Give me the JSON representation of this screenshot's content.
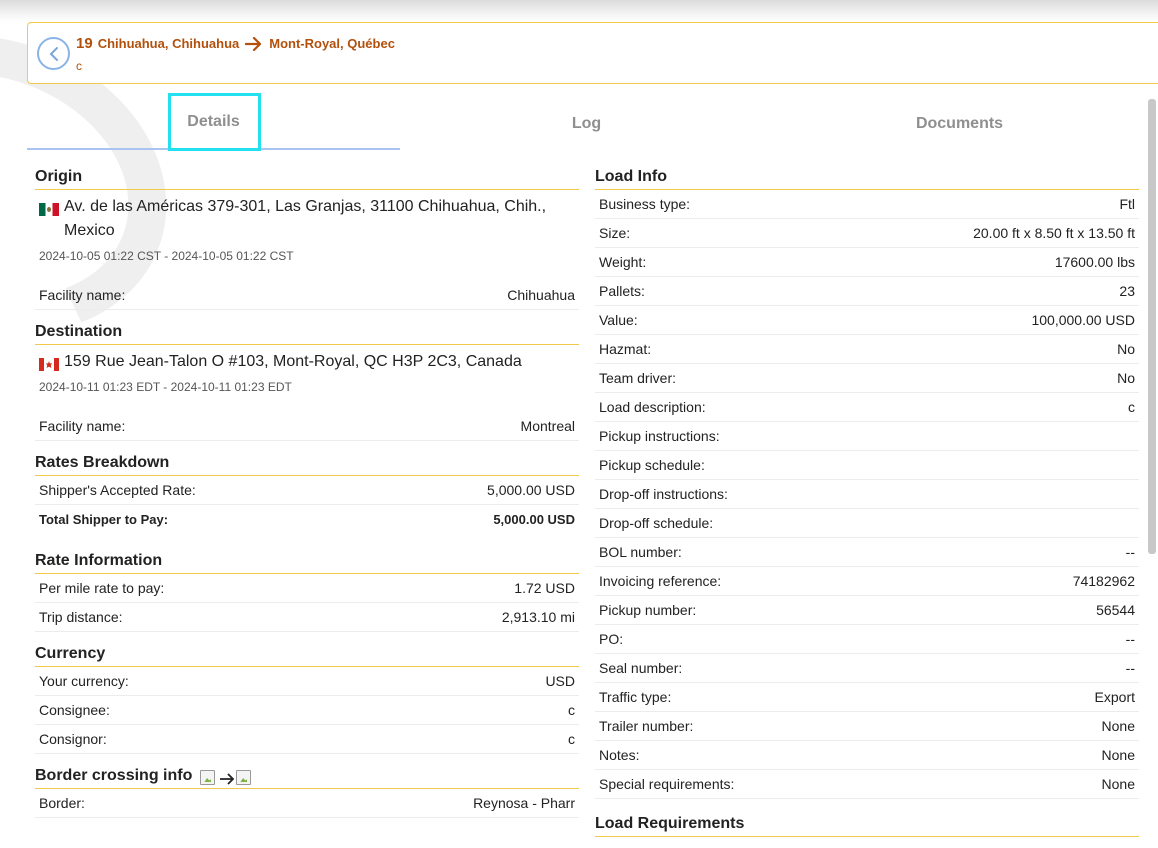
{
  "header": {
    "load_number": "19",
    "origin_city": "Chihuahua, Chihuahua",
    "destination_city": "Mont-Royal, Québec",
    "subline": "c"
  },
  "tabs": [
    {
      "label": "Details",
      "active": true
    },
    {
      "label": "Log",
      "active": false
    },
    {
      "label": "Documents",
      "active": false
    }
  ],
  "origin": {
    "title": "Origin",
    "address": "Av. de las Américas 379-301, Las Granjas, 31100 Chihuahua, Chih., Mexico",
    "dates": "2024-10-05 01:22 CST - 2024-10-05 01:22 CST",
    "facility_label": "Facility name:",
    "facility_value": "Chihuahua"
  },
  "destination": {
    "title": "Destination",
    "address": "159 Rue Jean-Talon O #103, Mont-Royal, QC H3P 2C3, Canada",
    "dates": "2024-10-11 01:23 EDT - 2024-10-11 01:23 EDT",
    "facility_label": "Facility name:",
    "facility_value": "Montreal"
  },
  "rates_breakdown": {
    "title": "Rates Breakdown",
    "rows": [
      {
        "label": "Shipper's Accepted Rate:",
        "value": "5,000.00 USD"
      },
      {
        "label": "Total Shipper to Pay:",
        "value": "5,000.00 USD"
      }
    ]
  },
  "rate_information": {
    "title": "Rate Information",
    "rows": [
      {
        "label": "Per mile rate to pay:",
        "value": "1.72 USD"
      },
      {
        "label": "Trip distance:",
        "value": "2,913.10 mi"
      }
    ]
  },
  "currency": {
    "title": "Currency",
    "rows": [
      {
        "label": "Your currency:",
        "value": "USD"
      },
      {
        "label": "Consignee:",
        "value": "c"
      },
      {
        "label": "Consignor:",
        "value": "c"
      }
    ]
  },
  "border": {
    "title": "Border crossing info",
    "rows": [
      {
        "label": "Border:",
        "value": "Reynosa - Pharr"
      }
    ]
  },
  "load_info": {
    "title": "Load Info",
    "rows": [
      {
        "label": "Business type:",
        "value": "Ftl"
      },
      {
        "label": "Size:",
        "value": "20.00 ft x 8.50 ft x 13.50 ft"
      },
      {
        "label": "Weight:",
        "value": "17600.00 lbs"
      },
      {
        "label": "Pallets:",
        "value": "23"
      },
      {
        "label": "Value:",
        "value": "100,000.00 USD"
      },
      {
        "label": "Hazmat:",
        "value": "No"
      },
      {
        "label": "Team driver:",
        "value": "No"
      },
      {
        "label": "Load description:",
        "value": "c"
      },
      {
        "label": "Pickup instructions:",
        "value": ""
      },
      {
        "label": "Pickup schedule:",
        "value": ""
      },
      {
        "label": "Drop-off instructions:",
        "value": ""
      },
      {
        "label": "Drop-off schedule:",
        "value": ""
      },
      {
        "label": "BOL number:",
        "value": "--"
      },
      {
        "label": "Invoicing reference:",
        "value": "74182962"
      },
      {
        "label": "Pickup number:",
        "value": "56544"
      },
      {
        "label": "PO:",
        "value": "--"
      },
      {
        "label": "Seal number:",
        "value": "--"
      },
      {
        "label": "Traffic type:",
        "value": "Export"
      },
      {
        "label": "Trailer number:",
        "value": "None"
      },
      {
        "label": "Notes:",
        "value": "None"
      },
      {
        "label": "Special requirements:",
        "value": "None"
      }
    ]
  },
  "load_requirements": {
    "title": "Load Requirements"
  },
  "icons": {
    "back": "back-arrow-icon",
    "route_arrow": "arrow-right-icon",
    "origin_flag": "mexico-flag-icon",
    "destination_flag": "canada-flag-icon"
  },
  "colors": {
    "accent_brown": "#b2500c",
    "section_line": "#f2c94c",
    "back_button": "#8ab4e6",
    "focus_outline": "#22e0f0"
  }
}
